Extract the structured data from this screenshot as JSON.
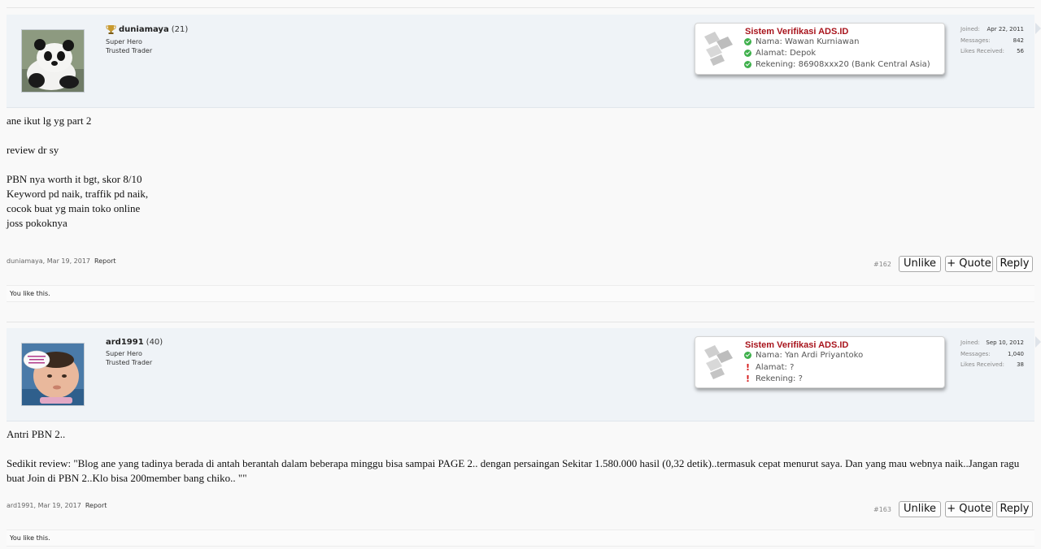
{
  "posts": [
    {
      "username": "duniamaya",
      "count": "(21)",
      "titles": [
        "Super Hero",
        "Trusted Trader"
      ],
      "verif": {
        "title": "Sistem Verifikasi ADS.ID",
        "nama": "Nama: Wawan Kurniawan",
        "alamat": "Alamat: Depok",
        "rekening": "Rekening: 86908xxx20 (Bank Central Asia)"
      },
      "stats": [
        {
          "label": "Joined:",
          "value": "Apr 22, 2011"
        },
        {
          "label": "Messages:",
          "value": "842"
        },
        {
          "label": "Likes Received:",
          "value": "56"
        }
      ],
      "message": "ane ikut lg yg part 2\n\nreview dr sy\n\nPBN nya worth it bgt, skor 8/10\nKeyword pd naik, traffik pd naik,\ncocok buat yg main toko online\njoss pokoknya",
      "meta": "duniamaya, Mar 19, 2017",
      "report": "Report",
      "postnum": "#162",
      "unlike": "Unlike",
      "quote": "+ Quote",
      "reply": "Reply",
      "likes": "You like this."
    },
    {
      "username": "ard1991",
      "count": "(40)",
      "titles": [
        "Super Hero",
        "Trusted Trader"
      ],
      "verif": {
        "title": "Sistem Verifikasi ADS.ID",
        "nama": "Nama: Yan Ardi Priyantoko",
        "alamat": "Alamat: ?",
        "rekening": "Rekening: ?"
      },
      "stats": [
        {
          "label": "Joined:",
          "value": "Sep 10, 2012"
        },
        {
          "label": "Messages:",
          "value": "1,040"
        },
        {
          "label": "Likes Received:",
          "value": "38"
        }
      ],
      "message": "Antri PBN 2..\n\nSedikit review: \"Blog ane yang tadinya berada di antah berantah dalam beberapa minggu bisa sampai PAGE 2.. dengan persaingan Sekitar 1.580.000 hasil (0,32 detik)..termasuk cepat menurut saya. Dan yang mau webnya naik..Jangan ragu buat Join di PBN 2..Klo bisa 200member bang chiko.. \"\"",
      "meta": "ard1991, Mar 19, 2017",
      "report": "Report",
      "postnum": "#163",
      "unlike": "Unlike",
      "quote": "+ Quote",
      "reply": "Reply",
      "likes": "You like this."
    }
  ],
  "colors": {
    "userbar": "#eff3f7",
    "verif_title": "#a8141c",
    "ok": "#3fb04c",
    "warn": "#d61b1b"
  }
}
